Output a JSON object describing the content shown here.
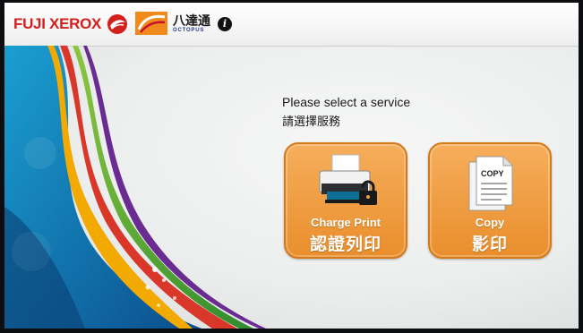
{
  "header": {
    "brand_text": "FUJI XEROX",
    "partner_name_cn": "八達通",
    "partner_name_en": "OCTOPUS",
    "info_glyph": "i"
  },
  "main": {
    "prompt_en": "Please select a service",
    "prompt_zh": "請選擇服務",
    "services": [
      {
        "label_en": "Charge Print",
        "label_zh": "認證列印",
        "icon": "printer-lock-icon"
      },
      {
        "label_en": "Copy",
        "label_zh": "影印",
        "icon": "copy-document-icon",
        "icon_text": "COPY"
      }
    ]
  },
  "colors": {
    "brand_red": "#d4201d",
    "button_orange": "#ef9d40",
    "button_border": "#d67a18"
  }
}
